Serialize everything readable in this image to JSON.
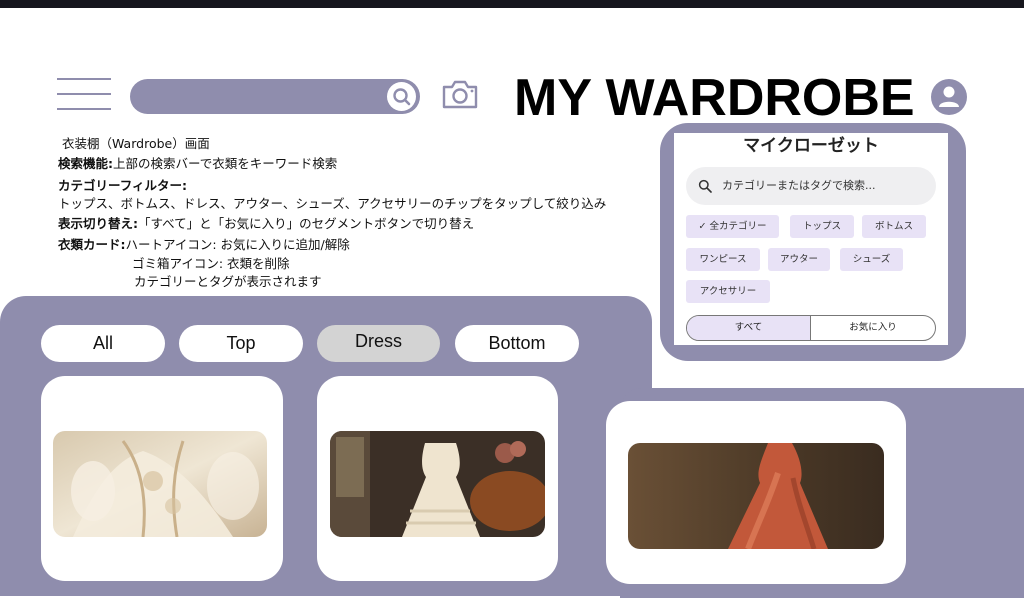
{
  "header": {
    "title": "MY WARDROBE",
    "search_value": ""
  },
  "description": {
    "line1": "衣装棚（Wardrobe）画面",
    "search_label": "検索機能:",
    "search_text": "上部の検索バーで衣類をキーワード検索",
    "category_label": "カテゴリーフィルター:",
    "category_text": "トップス、ボトムス、ドレス、アウター、シューズ、アクセサリーのチップをタップして絞り込み",
    "toggle_label": "表示切り替え:",
    "toggle_text": "「すべて」と「お気に入り」のセグメントボタンで切り替え",
    "card_label": "衣類カード:",
    "card_text1": "ハートアイコン: お気に入りに追加/解除",
    "card_text2": "ゴミ箱アイコン: 衣類を削除",
    "card_text3": "カテゴリーとタグが表示されます"
  },
  "phone": {
    "title": "マイクローゼット",
    "search_placeholder": "カテゴリーまたはタグで検索...",
    "chips": [
      {
        "label": "✓ 全カテゴリー"
      },
      {
        "label": "トップス"
      },
      {
        "label": "ボトムス"
      },
      {
        "label": "ワンピース"
      },
      {
        "label": "アウター"
      },
      {
        "label": "シューズ"
      },
      {
        "label": "アクセサリー"
      }
    ],
    "segment": {
      "all": "すべて",
      "favorites": "お気に入り"
    }
  },
  "tabs": [
    {
      "label": "All"
    },
    {
      "label": "Top"
    },
    {
      "label": "Dress",
      "selected": true
    },
    {
      "label": "Bottom"
    }
  ],
  "colors": {
    "accent": "#8f8dad",
    "chip": "#e8e2f6",
    "tab_active": "#d3d3d3"
  },
  "icons": [
    "menu-icon",
    "search-icon",
    "camera-icon",
    "user-avatar-icon"
  ]
}
